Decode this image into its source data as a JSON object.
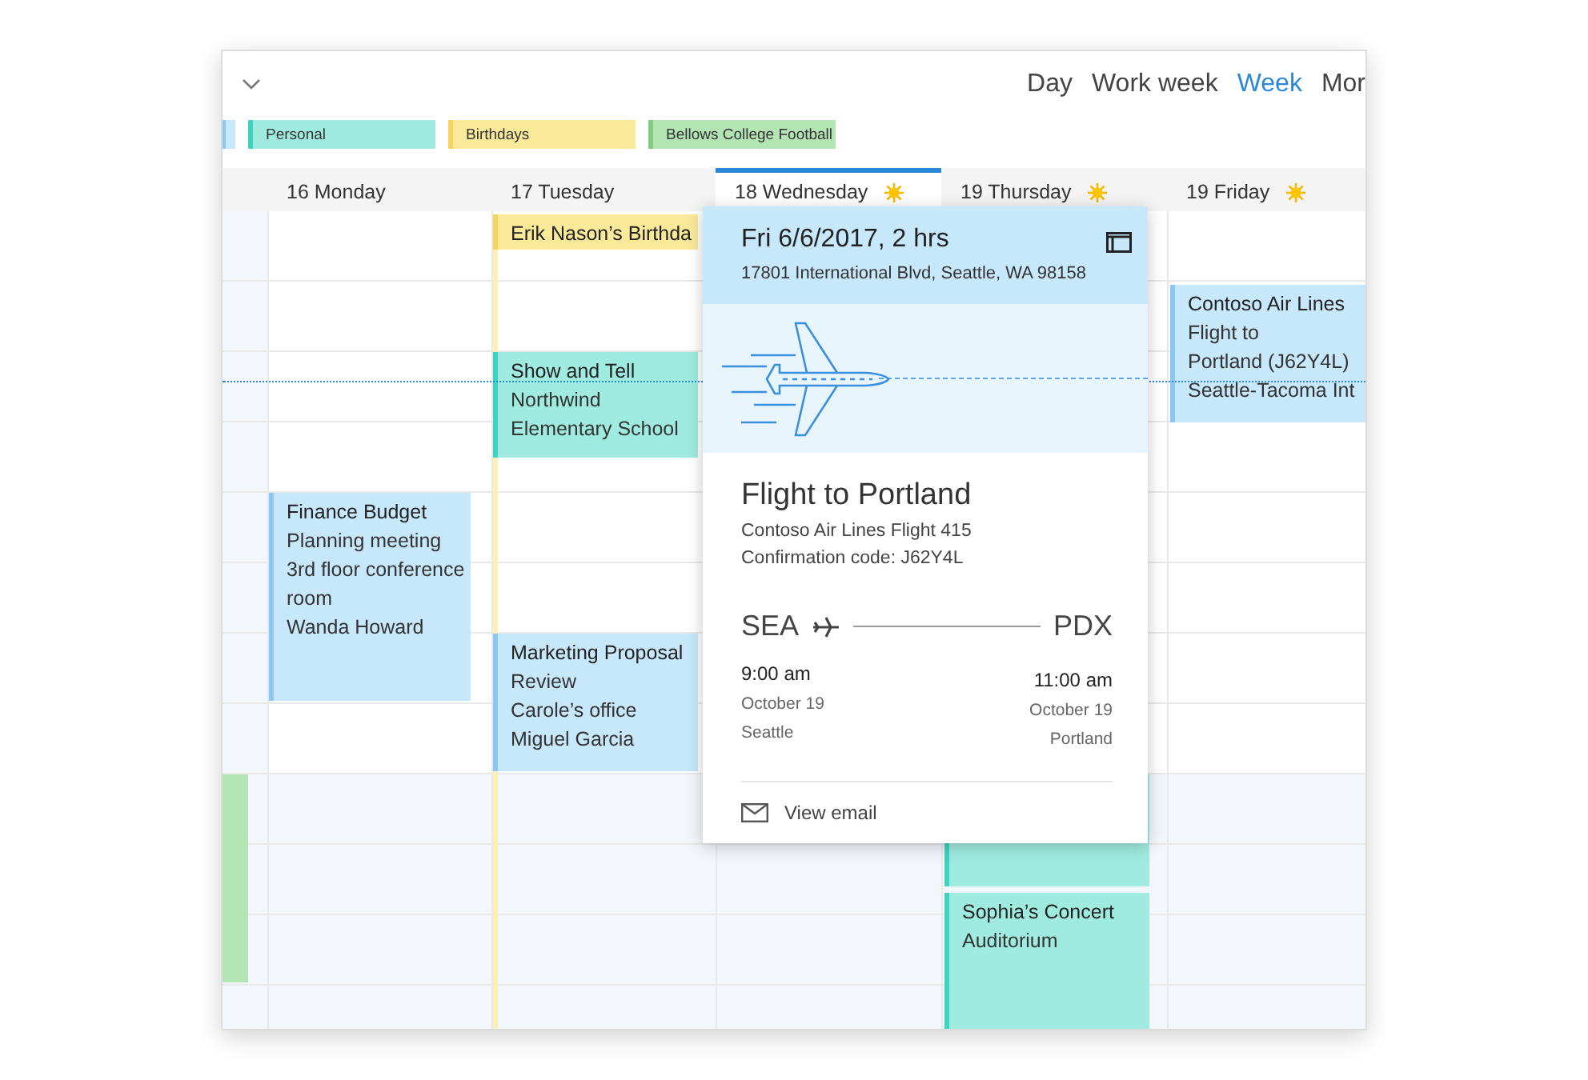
{
  "toolbar": {
    "views": [
      {
        "label": "Day",
        "selected": false
      },
      {
        "label": "Work week",
        "selected": false
      },
      {
        "label": "Week",
        "selected": true
      },
      {
        "label": "Mor",
        "selected": false
      }
    ]
  },
  "calendars": [
    {
      "color": "#c7e7fb"
    },
    {
      "name": "Personal",
      "color": "#a0ebe0"
    },
    {
      "name": "Birthdays",
      "color": "#fbe99a"
    },
    {
      "name": "Bellows College Football",
      "color": "#b3e4b3"
    }
  ],
  "days": [
    {
      "label": "16 Monday",
      "selected": false,
      "sunny": false,
      "events": [
        {
          "color": "#c7e7fb",
          "lines": [
            "Finance Budget",
            "Planning meeting",
            "3rd floor conference",
            "room",
            "Wanda Howard"
          ]
        }
      ]
    },
    {
      "label": "17 Tuesday",
      "selected": false,
      "sunny": false,
      "events": [
        {
          "color": "#fbe99a",
          "lines": [
            "Erik Nason’s Birthda"
          ]
        },
        {
          "color": "#a0ebe0",
          "lines": [
            "Show and Tell",
            "Northwind",
            "Elementary School"
          ]
        },
        {
          "color": "#c7e7fb",
          "lines": [
            "Marketing Proposal",
            "Review",
            "Carole’s office",
            "Miguel Garcia"
          ]
        }
      ]
    },
    {
      "label": "18 Wednesday",
      "selected": true,
      "sunny": true
    },
    {
      "label": "19 Thursday",
      "selected": false,
      "sunny": true,
      "events": [
        {
          "color": "#a0ebe0"
        },
        {
          "color": "#a0ebe0",
          "lines": [
            "Sophia’s Concert",
            "Auditorium"
          ]
        }
      ]
    },
    {
      "label": "19 Friday",
      "selected": false,
      "sunny": true,
      "events": [
        {
          "color": "#c7e7fb",
          "lines": [
            "Contoso Air Lines",
            "Flight to",
            "Portland (J62Y4L)",
            "Seattle-Tacoma Int"
          ]
        }
      ]
    }
  ],
  "popup": {
    "when": "Fri 6/6/2017, 2 hrs",
    "address": "17801 International Blvd, Seattle, WA 98158",
    "title": "Flight to Portland",
    "flight": "Contoso Air Lines Flight 415",
    "confirmation": "Confirmation code: J62Y4L",
    "from": {
      "code": "SEA",
      "time": "9:00 am",
      "date": "October 19",
      "city": "Seattle"
    },
    "to": {
      "code": "PDX",
      "time": "11:00 am",
      "date": "October 19",
      "city": "Portland"
    },
    "action": "View email"
  }
}
